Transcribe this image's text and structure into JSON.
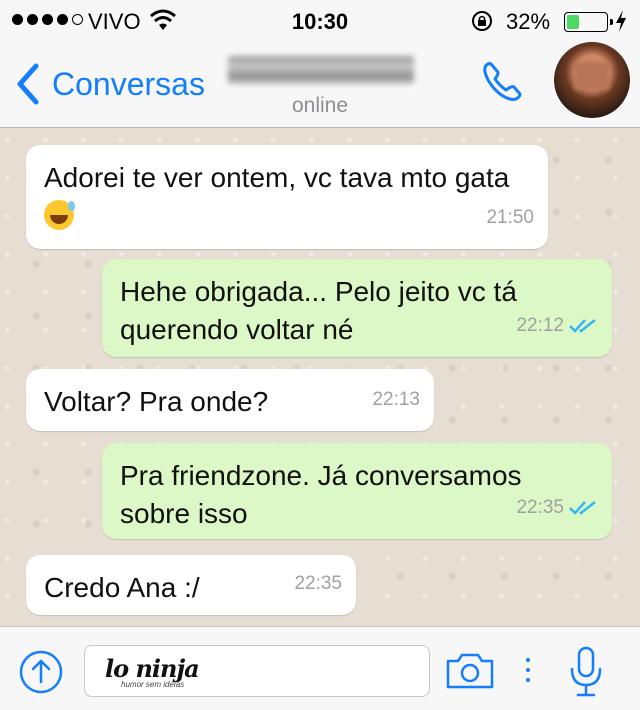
{
  "status_bar": {
    "carrier": "VIVO",
    "time": "10:30",
    "battery_percent": "32%",
    "battery_level": 0.32,
    "icons": [
      "signal-dots-icon",
      "wifi-icon",
      "rotation-lock-icon",
      "battery-icon",
      "charging-bolt-icon"
    ]
  },
  "nav": {
    "back_label": "Conversas",
    "presence": "online",
    "icons": [
      "chevron-left-icon",
      "phone-icon",
      "avatar"
    ]
  },
  "messages": [
    {
      "direction": "in",
      "text": "Adorei te ver ontem, vc tava mto gata",
      "emoji": "sweat-smile-emoji",
      "time": "21:50"
    },
    {
      "direction": "out",
      "text": "Hehe obrigada... Pelo jeito vc tá querendo voltar né",
      "time": "22:12",
      "status": "read"
    },
    {
      "direction": "in",
      "text": "Voltar? Pra onde?",
      "time": "22:13"
    },
    {
      "direction": "out",
      "text": "Pra friendzone. Já conversamos sobre isso",
      "time": "22:35",
      "status": "read"
    },
    {
      "direction": "in",
      "text": "Credo Ana :/",
      "time": "22:35"
    }
  ],
  "input_bar": {
    "watermark": "lo ninja",
    "watermark_sub": "humor sem ideias",
    "icons": [
      "upload-icon",
      "camera-icon",
      "more-dots-icon",
      "microphone-icon"
    ]
  },
  "colors": {
    "accent": "#157efb",
    "outgoing_bubble": "#dcf8c6",
    "incoming_bubble": "#ffffff",
    "read_ticks": "#34b7f1",
    "battery": "#4cd964"
  }
}
